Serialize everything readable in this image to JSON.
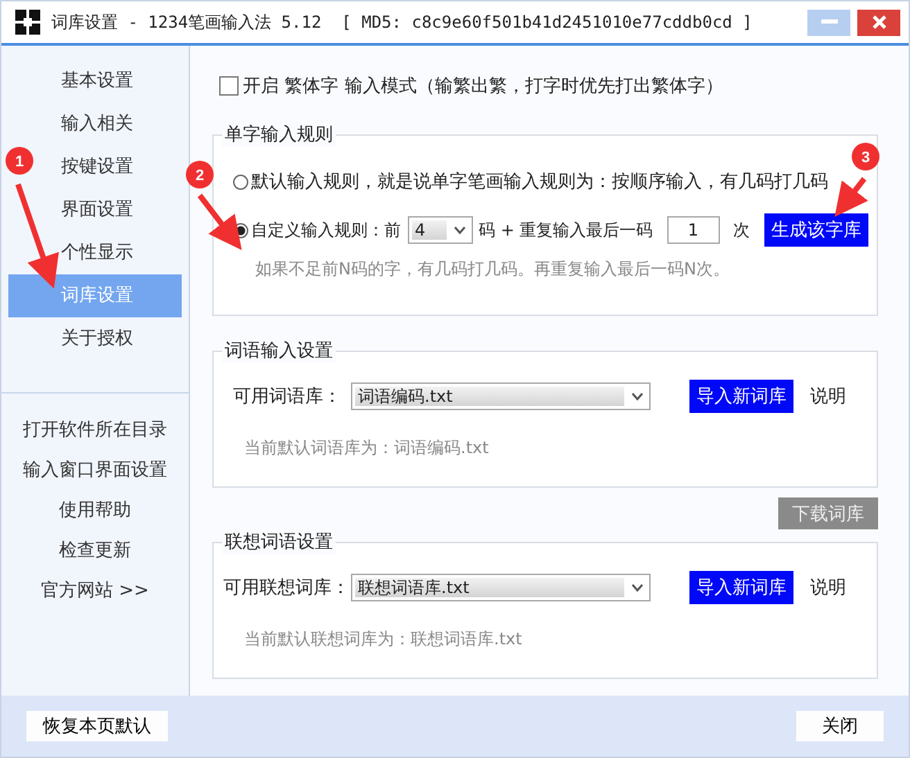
{
  "window": {
    "title": "词库设置 - 1234笔画输入法 5.12  [ MD5: c8c9e60f501b41d2451010e77cddb0cd ]"
  },
  "sidebar": {
    "items": [
      {
        "label": "基本设置",
        "selected": false
      },
      {
        "label": "输入相关",
        "selected": false
      },
      {
        "label": "按键设置",
        "selected": false
      },
      {
        "label": "界面设置",
        "selected": false
      },
      {
        "label": "个性显示",
        "selected": false
      },
      {
        "label": "词库设置",
        "selected": true
      },
      {
        "label": "关于授权",
        "selected": false
      }
    ],
    "links": [
      "打开软件所在目录",
      "输入窗口界面设置",
      "使用帮助",
      "检查更新",
      "官方网站 >>"
    ],
    "restore_button": "恢复本页默认"
  },
  "traditional_mode": {
    "label": "开启 繁体字 输入模式（输繁出繁，打字时优先打出繁体字）",
    "checked": false
  },
  "single_char_rule": {
    "title": "单字输入规则",
    "options": [
      {
        "kind": "plain",
        "label": "默认输入规则，就是说单字笔画输入规则为：按顺序输入，有几码打几码",
        "selected": false
      },
      {
        "kind": "custom",
        "label": "自定义输入规则：前",
        "code_count": "4",
        "code_suffix": "码 + 重复输入最后一码",
        "repeat_count": "1",
        "repeat_suffix": "次",
        "selected": true
      }
    ],
    "generate_button": "生成该字库",
    "hint": "如果不足前N码的字，有几码打几码。再重复输入最后一码N次。"
  },
  "phrase_settings": {
    "title": "词语输入设置",
    "label": "可用词语库：",
    "value": "词语编码.txt",
    "import_button": "导入新词库",
    "help_link": "说明",
    "current": "当前默认词语库为：词语编码.txt"
  },
  "download_button": "下载词库",
  "association_settings": {
    "title": "联想词语设置",
    "label": "可用联想词库：",
    "value": "联想词语库.txt",
    "import_button": "导入新词库",
    "help_link": "说明",
    "current": "当前默认联想词库为：联想词语库.txt"
  },
  "close_button": "关闭",
  "annotations": [
    {
      "label": "1"
    },
    {
      "label": "2"
    },
    {
      "label": "3"
    }
  ]
}
